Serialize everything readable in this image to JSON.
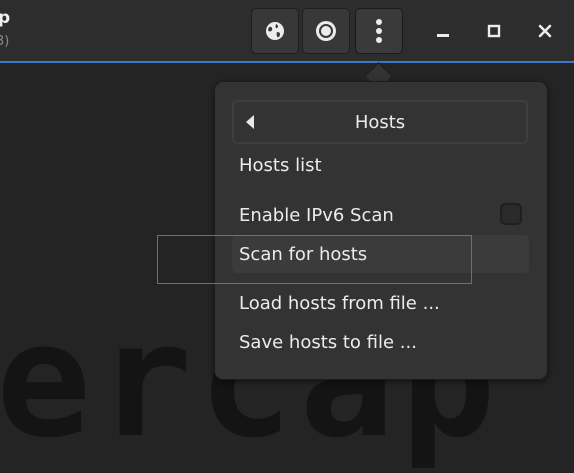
{
  "window": {
    "title_fragment": "p",
    "subtitle_fragment": "3)"
  },
  "header_buttons": {
    "globe_icon": "globe-icon",
    "record_icon": "record-icon",
    "menu_icon": "vertical-ellipsis-icon"
  },
  "window_controls": {
    "minimize_icon": "minimize-icon",
    "maximize_icon": "maximize-icon",
    "close_icon": "close-icon"
  },
  "background_logo_text": "ercap",
  "popover": {
    "submenu_title": "Hosts",
    "items": [
      {
        "label": "Hosts list"
      },
      {
        "label": "Enable IPv6 Scan",
        "checked": false
      },
      {
        "label": "Scan for hosts"
      },
      {
        "label": "Load hosts from file ..."
      },
      {
        "label": "Save hosts to file ..."
      }
    ]
  },
  "colors": {
    "accent": "#3c78c9",
    "highlight": "#d9414b"
  }
}
